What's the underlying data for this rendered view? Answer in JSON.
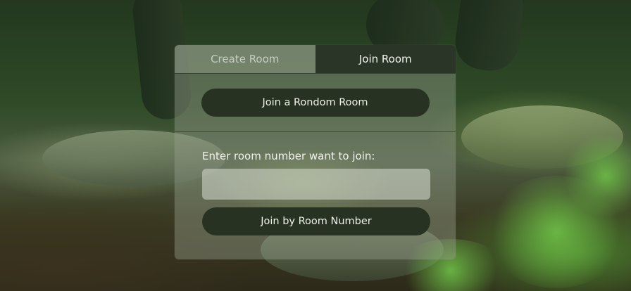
{
  "tabs": {
    "create_room": "Create Room",
    "join_room": "Join Room",
    "active": "join_room"
  },
  "random_room": {
    "button_label": "Join a Rondom Room"
  },
  "join_by_number": {
    "label": "Enter room number want to join:",
    "input_value": "",
    "input_placeholder": "",
    "button_label": "Join by Room Number"
  },
  "colors": {
    "button_bg": "#273223",
    "active_tab_bg": "#2b3527",
    "panel_overlay": "rgba(150,160,140,0.42)"
  }
}
